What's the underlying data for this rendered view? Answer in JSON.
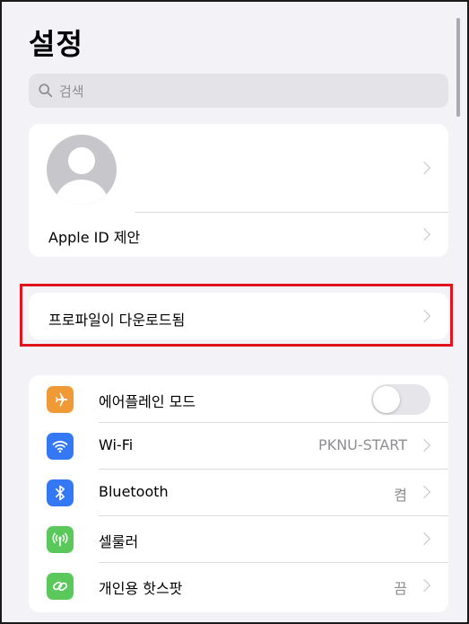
{
  "header": {
    "title": "설정"
  },
  "search": {
    "placeholder": "검색"
  },
  "account": {
    "apple_id_label": "Apple ID 제안"
  },
  "profile_notice": {
    "label": "프로파일이 다운로드됨"
  },
  "settings": {
    "airplane": {
      "label": "에어플레인 모드",
      "icon": "airplane-icon",
      "color": "#f09a37",
      "toggle_on": false
    },
    "wifi": {
      "label": "Wi-Fi",
      "value": "PKNU-START",
      "icon": "wifi-icon",
      "color": "#3478f6"
    },
    "bluetooth": {
      "label": "Bluetooth",
      "value": "켬",
      "icon": "bluetooth-icon",
      "color": "#3478f6"
    },
    "cellular": {
      "label": "셀룰러",
      "icon": "cellular-antenna-icon",
      "color": "#5ac85a"
    },
    "hotspot": {
      "label": "개인용 핫스팟",
      "value": "끔",
      "icon": "hotspot-link-icon",
      "color": "#5ac85a"
    }
  },
  "colors": {
    "highlight_border": "#e0141c",
    "background": "#f2f2f7"
  }
}
